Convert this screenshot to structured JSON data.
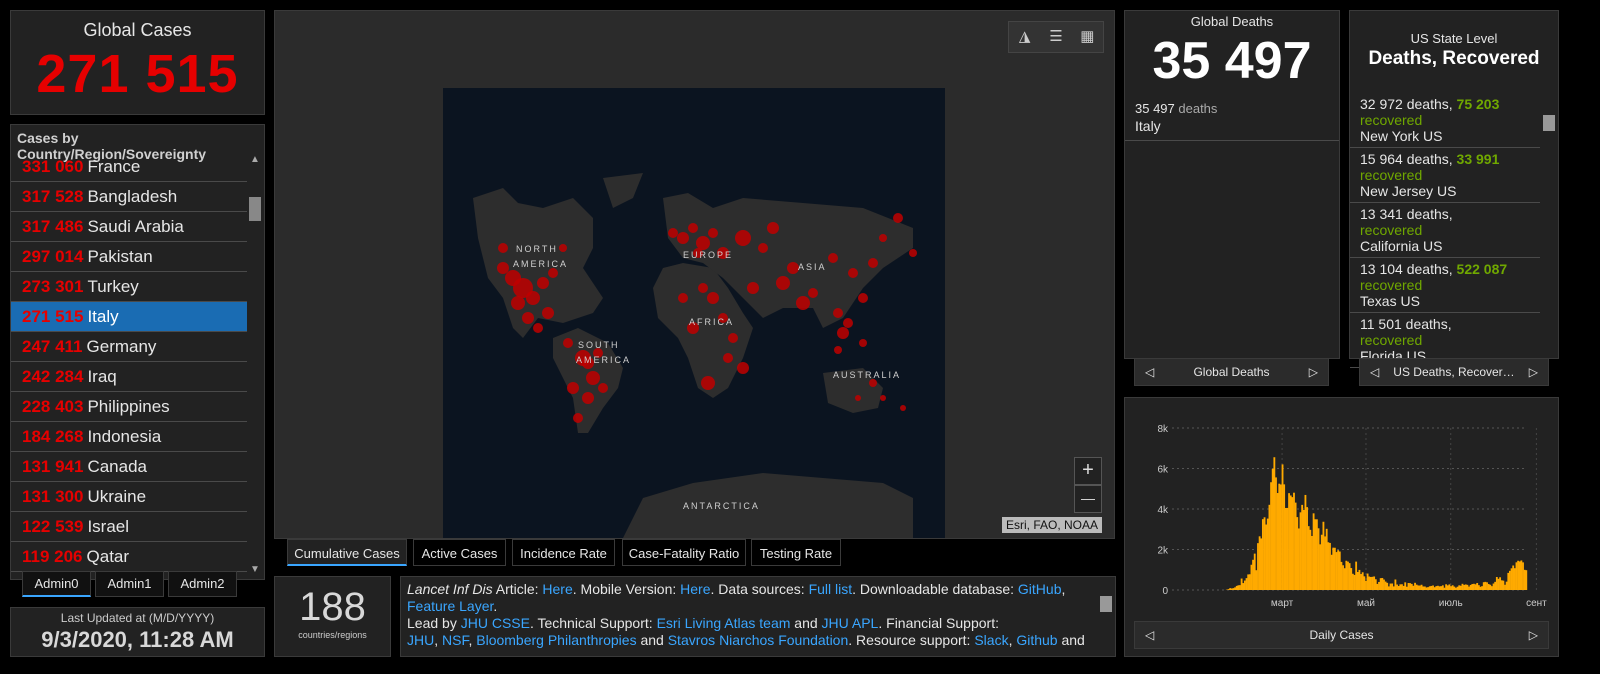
{
  "global_cases": {
    "title": "Global Cases",
    "value": "271 515"
  },
  "country_list": {
    "header": "Cases by Country/Region/Sovereignty",
    "rows": [
      {
        "num": "331 060",
        "name": "France"
      },
      {
        "num": "317 528",
        "name": "Bangladesh"
      },
      {
        "num": "317 486",
        "name": "Saudi Arabia"
      },
      {
        "num": "297 014",
        "name": "Pakistan"
      },
      {
        "num": "273 301",
        "name": "Turkey"
      },
      {
        "num": "271 515",
        "name": "Italy",
        "selected": true
      },
      {
        "num": "247 411",
        "name": "Germany"
      },
      {
        "num": "242 284",
        "name": "Iraq"
      },
      {
        "num": "228 403",
        "name": "Philippines"
      },
      {
        "num": "184 268",
        "name": "Indonesia"
      },
      {
        "num": "131 941",
        "name": "Canada"
      },
      {
        "num": "131 300",
        "name": "Ukraine"
      },
      {
        "num": "122 539",
        "name": "Israel"
      },
      {
        "num": "119 206",
        "name": "Qatar"
      }
    ]
  },
  "admin_tabs": [
    "Admin0",
    "Admin1",
    "Admin2"
  ],
  "last_updated": {
    "label": "Last Updated at (M/D/YYYY)",
    "value": "9/3/2020, 11:28 AM"
  },
  "map": {
    "labels": {
      "north_america_1": "NORTH",
      "north_america_2": "AMERICA",
      "europe": "EUROPE",
      "asia": "ASIA",
      "africa": "AFRICA",
      "south_america_1": "SOUTH",
      "south_america_2": "AMERICA",
      "australia": "AUSTRALIA",
      "antarctica": "ANTARCTICA"
    },
    "zoom_in": "+",
    "zoom_out": "—",
    "attribution": "Esri, FAO, NOAA",
    "icons": [
      "bookmark-icon",
      "list-icon",
      "qr-icon"
    ]
  },
  "map_tabs": [
    "Cumulative Cases",
    "Active Cases",
    "Incidence Rate",
    "Case-Fatality Ratio",
    "Testing Rate"
  ],
  "countries_count": {
    "value": "188",
    "label": "countries/regions"
  },
  "info": {
    "lancet": "Lancet Inf Dis",
    "article": " Article: ",
    "here1": "Here",
    "mobile": ". Mobile Version: ",
    "here2": "Here",
    "sources": ". Data sources: ",
    "full_list": "Full list",
    "download": ". Downloadable database: ",
    "github": "GitHub",
    "comma1": ",",
    "feature_layer": "Feature Layer",
    "dot1": ".",
    "lead_by": "Lead by ",
    "jhu_csse": "JHU CSSE",
    "tech": ". Technical Support: ",
    "esri": "Esri Living Atlas team",
    "and1": " and ",
    "jhu_apl": "JHU APL",
    "fin": ". Financial Support:",
    "jhu": "JHU",
    "comma2": ", ",
    "nsf": "NSF",
    "comma3": ", ",
    "bloomberg": "Bloomberg Philanthropies",
    "and2": " and ",
    "stavros": "Stavros Niarchos Foundation",
    "res": ". Resource support: ",
    "slack": "Slack",
    "comma4": ", ",
    "github2": "Github",
    "and3": " and"
  },
  "global_deaths": {
    "title": "Global Deaths",
    "value": "35 497",
    "detail_num": "35 497",
    "detail_unit": " deaths",
    "detail_country": "Italy",
    "nav_label": "Global Deaths"
  },
  "us_state": {
    "title1": "US State Level",
    "title2": "Deaths, Recovered",
    "items": [
      {
        "deaths": "32 972 deaths,",
        "recovered_num": " 75 203",
        "recovered": "recovered",
        "state": "New York US"
      },
      {
        "deaths": "15 964 deaths,",
        "recovered_num": " 33 991",
        "recovered": "recovered",
        "state": "New Jersey US"
      },
      {
        "deaths": "13 341 deaths,",
        "recovered_num": "",
        "recovered": " recovered",
        "state": "California US"
      },
      {
        "deaths": "13 104 deaths,",
        "recovered_num": " 522 087",
        "recovered": "recovered",
        "state": "Texas US"
      },
      {
        "deaths": "11 501 deaths,",
        "recovered_num": "",
        "recovered": " recovered",
        "state": "Florida US"
      }
    ],
    "nav_label": "US Deaths, Recover…"
  },
  "chart_nav_label": "Daily Cases",
  "colors": {
    "accent": "#3aa6ff",
    "cases_red": "#e60000",
    "recovered_green": "#70a800",
    "bar": "#ffaa00"
  },
  "chart_data": {
    "type": "bar",
    "title": "Daily Cases",
    "yticks": [
      "0",
      "2k",
      "4k",
      "6k",
      "8k"
    ],
    "ylim": [
      0,
      8000
    ],
    "xticks": [
      "март",
      "май",
      "июль",
      "сент"
    ],
    "grid": true,
    "x_start": "2020-01-22",
    "values": [
      0,
      0,
      0,
      0,
      0,
      0,
      0,
      0,
      0,
      0,
      0,
      0,
      0,
      0,
      0,
      0,
      0,
      0,
      0,
      0,
      0,
      0,
      0,
      0,
      0,
      0,
      0,
      0,
      0,
      0,
      0,
      0,
      2,
      17,
      42,
      93,
      74,
      93,
      131,
      202,
      233,
      240,
      566,
      342,
      466,
      587,
      769,
      778,
      1247,
      1492,
      1797,
      977,
      2313,
      2651,
      2547,
      3497,
      3590,
      3233,
      3526,
      4207,
      5322,
      5986,
      6557,
      5560,
      4789,
      5249,
      5210,
      6203,
      5217,
      4050,
      4053,
      4782,
      4668,
      4585,
      4805,
      4316,
      3599,
      3039,
      3836,
      4204,
      3951,
      4694,
      4092,
      3153,
      2972,
      2667,
      3786,
      3493,
      3491,
      3047,
      2256,
      2729,
      3370,
      2646,
      3021,
      2357,
      2324,
      1739,
      2091,
      2086,
      1872,
      1965,
      1900,
      1389,
      1221,
      1075,
      1444,
      1401,
      1327,
      1083,
      802,
      744,
      1402,
      888,
      992,
      789,
      875,
      675,
      451,
      813,
      665,
      642,
      652,
      669,
      531,
      300,
      397,
      584,
      593,
      516,
      416,
      355,
      178,
      318,
      321,
      177,
      518,
      270,
      197,
      280,
      283,
      202,
      379,
      163,
      346,
      338,
      301,
      210,
      355,
      264,
      224,
      221,
      259,
      175,
      174,
      126,
      142,
      182,
      201,
      223,
      138,
      192,
      208,
      180,
      190,
      230,
      114,
      282,
      229,
      276,
      188,
      234,
      169,
      114,
      163,
      230,
      212,
      306,
      252,
      275,
      255,
      170,
      249,
      295,
      306,
      280,
      347,
      239,
      159,
      190,
      384,
      402,
      379,
      295,
      259,
      190,
      320,
      403,
      642,
      552,
      629,
      479,
      463,
      259,
      412,
      845,
      947,
      1071,
      1210,
      1077,
      1367,
      1444,
      1411,
      1460,
      1365,
      996,
      978
    ]
  }
}
